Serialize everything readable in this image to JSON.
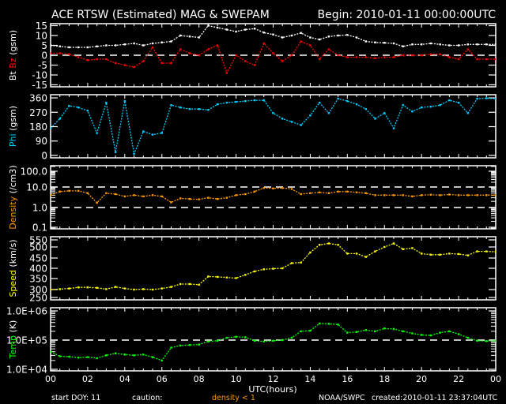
{
  "header": {
    "title": "ACE RTSW (Estimated) MAG & SWEPAM",
    "begin": "Begin: 2010-01-11 00:00:00UTC"
  },
  "footer": {
    "start_doy": "start DOY:  11",
    "caution": "caution:",
    "density_caution": "density < 1",
    "source": "NOAA/SWPC",
    "created": "created:2010-01-11 23:37:04UTC",
    "density_caution_color": "#ff9900"
  },
  "chart_data": {
    "type": "scatter",
    "xlabel": "UTC(hours)",
    "xlim": [
      0,
      24
    ],
    "xtick_labels": [
      "00",
      "02",
      "04",
      "06",
      "08",
      "10",
      "12",
      "14",
      "16",
      "18",
      "20",
      "22",
      "00"
    ],
    "x": [
      0,
      0.5,
      1,
      1.5,
      2,
      2.5,
      3,
      3.5,
      4,
      4.5,
      5,
      5.5,
      6,
      6.5,
      7,
      7.5,
      8,
      8.5,
      9,
      9.5,
      10,
      10.5,
      11,
      11.5,
      12,
      12.5,
      13,
      13.5,
      14,
      14.5,
      15,
      15.5,
      16,
      16.5,
      17,
      17.5,
      18,
      18.5,
      19,
      19.5,
      20,
      20.5,
      21,
      21.5,
      22,
      22.5,
      23,
      23.5,
      24
    ],
    "panels": [
      {
        "id": "mag",
        "ylabel_parts": [
          {
            "text": "Bt",
            "color": "#ffffff"
          },
          {
            "text": "Bz",
            "color": "#ff0000"
          },
          {
            "text": "(gsm)",
            "color": "#ffffff"
          }
        ],
        "yscale": "linear",
        "ylim": [
          -16,
          16
        ],
        "yticks": [
          15,
          10,
          5,
          0,
          -5,
          -10,
          -15
        ],
        "ytick_labels": [
          "15",
          "10",
          "5",
          "0",
          "-5",
          "-10",
          "-15"
        ],
        "reference_lines": [
          0
        ],
        "series": [
          {
            "name": "Bt",
            "color": "#ffffff",
            "values": [
              5,
              4.5,
              4,
              4,
              4,
              4.5,
              5,
              5,
              5.5,
              6,
              5,
              6,
              6.5,
              7,
              10,
              9.5,
              9,
              15,
              14,
              13,
              12,
              13,
              13.5,
              11.5,
              10.5,
              9,
              10,
              11.3,
              9,
              8,
              9.5,
              10,
              10.3,
              9,
              7,
              6.5,
              6.3,
              6,
              4.5,
              5.5,
              5.5,
              6,
              5.5,
              5,
              5,
              5.5,
              5.5,
              5.5,
              5.5
            ]
          },
          {
            "name": "Bz",
            "color": "#ff0000",
            "values": [
              1,
              1,
              0.5,
              -1,
              -2.5,
              -2,
              -2,
              -4,
              -5,
              -6,
              -3,
              4,
              -4,
              -4,
              3,
              1,
              0,
              3,
              5,
              -9,
              0,
              -3,
              -5,
              6,
              1,
              -3,
              0,
              7,
              5,
              -2,
              3,
              0,
              -1,
              -1,
              -1,
              -1.5,
              -1,
              -1,
              0,
              0,
              0,
              0.5,
              0.5,
              -1,
              -2,
              3,
              -2,
              -2,
              -2
            ]
          }
        ]
      },
      {
        "id": "phi",
        "ylabel_parts": [
          {
            "text": "Phi",
            "color": "#00ccff"
          },
          {
            "text": "(gsm)",
            "color": "#ffffff"
          }
        ],
        "yscale": "linear",
        "ylim": [
          -15,
          380
        ],
        "yticks": [
          360,
          270,
          180,
          90,
          0
        ],
        "ytick_labels": [
          "360",
          "270",
          "180",
          "90",
          "0"
        ],
        "reference_lines": [],
        "series": [
          {
            "name": "Phi",
            "color": "#00ccff",
            "values": [
              170,
              230,
              310,
              300,
              280,
              140,
              330,
              20,
              340,
              10,
              150,
              130,
              140,
              315,
              300,
              290,
              290,
              285,
              320,
              330,
              335,
              340,
              345,
              345,
              265,
              230,
              210,
              190,
              250,
              330,
              265,
              355,
              340,
              320,
              290,
              230,
              265,
              170,
              315,
              275,
              300,
              305,
              315,
              345,
              330,
              265,
              355,
              358,
              355
            ]
          }
        ]
      },
      {
        "id": "density",
        "ylabel_parts": [
          {
            "text": "Density",
            "color": "#ff9900"
          },
          {
            "text": "(/cm3)",
            "color": "#ffffff"
          }
        ],
        "yscale": "log",
        "ylim": [
          0.08,
          200
        ],
        "yticks": [
          100,
          10,
          1,
          0.1
        ],
        "ytick_labels": [
          "100.0",
          "10.0",
          "1.0",
          "0.1"
        ],
        "reference_lines": [
          10,
          1
        ],
        "series": [
          {
            "name": "Density",
            "color": "#ff9900",
            "values": [
              4,
              6,
              6.5,
              6.5,
              5,
              1.7,
              5,
              4.5,
              3.5,
              4,
              3.5,
              4,
              3.5,
              1.8,
              2.8,
              2.6,
              2.5,
              3,
              2.6,
              3,
              4,
              4.5,
              6,
              9,
              8.5,
              9,
              8,
              4.5,
              5,
              5.5,
              5,
              6,
              6,
              5.5,
              5,
              4,
              4,
              4,
              4,
              3.5,
              4,
              4.2,
              4,
              4.3,
              4,
              4,
              4,
              4,
              4
            ]
          }
        ]
      },
      {
        "id": "speed",
        "ylabel_parts": [
          {
            "text": "Speed",
            "color": "#ffff00"
          },
          {
            "text": "(km/s)",
            "color": "#ffffff"
          }
        ],
        "yscale": "nonlinear",
        "ylim": [
          240,
          560
        ],
        "yticks": [
          550,
          500,
          450,
          400,
          350,
          300,
          250
        ],
        "ytick_labels": [
          "550",
          "500",
          "450",
          "400",
          "350",
          "300",
          "250"
        ],
        "reference_lines": [],
        "series": [
          {
            "name": "Speed",
            "color": "#ffff00",
            "values": [
              300,
              302,
              305,
              310,
              310,
              308,
              302,
              312,
              305,
              300,
              302,
              300,
              305,
              312,
              325,
              325,
              322,
              360,
              358,
              355,
              352,
              368,
              385,
              395,
              398,
              400,
              425,
              428,
              475,
              515,
              525,
              515,
              470,
              470,
              455,
              480,
              500,
              525,
              490,
              495,
              470,
              465,
              465,
              470,
              468,
              462,
              480,
              480,
              478
            ]
          }
        ]
      },
      {
        "id": "temp",
        "ylabel_parts": [
          {
            "text": "Temp",
            "color": "#00ff00"
          },
          {
            "text": "(K)",
            "color": "#ffffff"
          }
        ],
        "yscale": "log",
        "ylim": [
          8900,
          1300000
        ],
        "yticks": [
          1000000,
          100000,
          10000
        ],
        "ytick_labels": [
          "1.0E+06",
          "1.0E+05",
          "1.0E+04"
        ],
        "reference_lines": [
          100000
        ],
        "series": [
          {
            "name": "Temp",
            "color": "#00ff00",
            "values": [
              40000,
              28000,
              27000,
              25000,
              26000,
              24000,
              30000,
              35000,
              32000,
              30000,
              32000,
              26000,
              20000,
              55000,
              65000,
              68000,
              70000,
              90000,
              95000,
              120000,
              130000,
              125000,
              95000,
              90000,
              95000,
              100000,
              120000,
              200000,
              210000,
              370000,
              360000,
              340000,
              180000,
              190000,
              220000,
              200000,
              250000,
              240000,
              200000,
              170000,
              150000,
              145000,
              180000,
              200000,
              160000,
              120000,
              95000,
              92000,
              95000
            ]
          }
        ]
      }
    ]
  }
}
